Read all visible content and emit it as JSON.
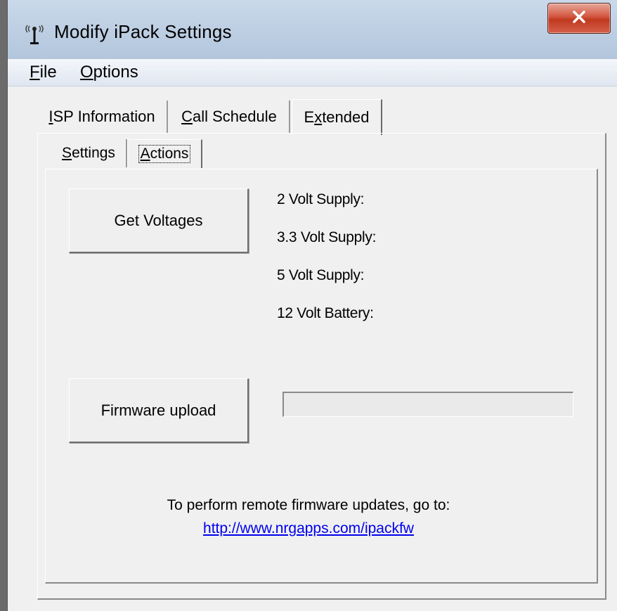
{
  "window": {
    "title": "Modify iPack Settings",
    "app_icon": "antenna-icon",
    "close_icon": "close-icon"
  },
  "menu": {
    "file": {
      "accel": "F",
      "rest": "ile"
    },
    "options": {
      "accel": "O",
      "rest": "ptions"
    }
  },
  "tabs": [
    {
      "accel": "I",
      "rest": "SP Information",
      "active": false
    },
    {
      "accel": "C",
      "rest": "all Schedule",
      "active": false
    },
    {
      "pre": "E",
      "accel": "x",
      "rest": "tended",
      "active": true
    }
  ],
  "subtabs": [
    {
      "accel": "S",
      "rest": "ettings",
      "active": false
    },
    {
      "accel": "A",
      "rest": "ctions",
      "active": true
    }
  ],
  "actions": {
    "get_voltages_label": "Get Voltages",
    "firmware_upload_label": "Firmware upload",
    "voltage_labels": [
      "2 Volt Supply:",
      "3.3 Volt Supply:",
      "5 Volt Supply:",
      "12 Volt Battery:"
    ],
    "upload_progress": 0,
    "remote_note": "To perform remote firmware updates, go to:",
    "remote_link": "http://www.nrgapps.com/ipackfw"
  },
  "colors": {
    "close_button": "#c7402b",
    "link": "#0000ee",
    "titlebar": "#bfd0e4",
    "progress_fill": "#3cb043"
  }
}
